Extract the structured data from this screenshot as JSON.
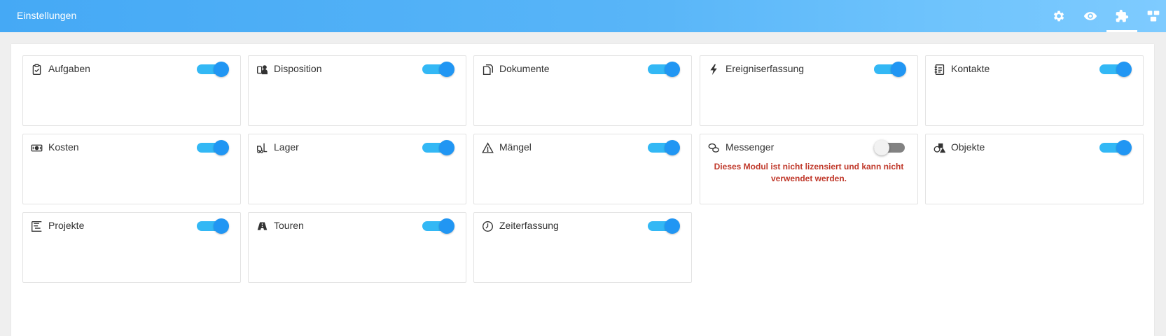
{
  "header": {
    "title": "Einstellungen",
    "icons": [
      "gear-icon",
      "eye-icon",
      "puzzle-icon",
      "modules-icon"
    ]
  },
  "colors": {
    "accent": "#2196f3",
    "toggle_track_on": "#33b8f5",
    "notice": "#c0392b"
  },
  "modules": [
    {
      "label": "Aufgaben",
      "icon": "clipboard-check-icon",
      "enabled": true
    },
    {
      "label": "Disposition",
      "icon": "dispatch-icon",
      "enabled": true
    },
    {
      "label": "Dokumente",
      "icon": "documents-icon",
      "enabled": true
    },
    {
      "label": "Ereigniserfassung",
      "icon": "lightning-icon",
      "enabled": true
    },
    {
      "label": "Kontakte",
      "icon": "address-book-icon",
      "enabled": true
    },
    {
      "label": "Kosten",
      "icon": "money-icon",
      "enabled": true
    },
    {
      "label": "Lager",
      "icon": "forklift-icon",
      "enabled": true
    },
    {
      "label": "Mängel",
      "icon": "warning-icon",
      "enabled": true
    },
    {
      "label": "Messenger",
      "icon": "chat-icon",
      "enabled": false,
      "notice": "Dieses Modul ist nicht lizensiert und kann nicht verwendet werden."
    },
    {
      "label": "Objekte",
      "icon": "objects-icon",
      "enabled": true
    },
    {
      "label": "Projekte",
      "icon": "project-icon",
      "enabled": true
    },
    {
      "label": "Touren",
      "icon": "road-icon",
      "enabled": true
    },
    {
      "label": "Zeiterfassung",
      "icon": "clock-icon",
      "enabled": true
    }
  ]
}
